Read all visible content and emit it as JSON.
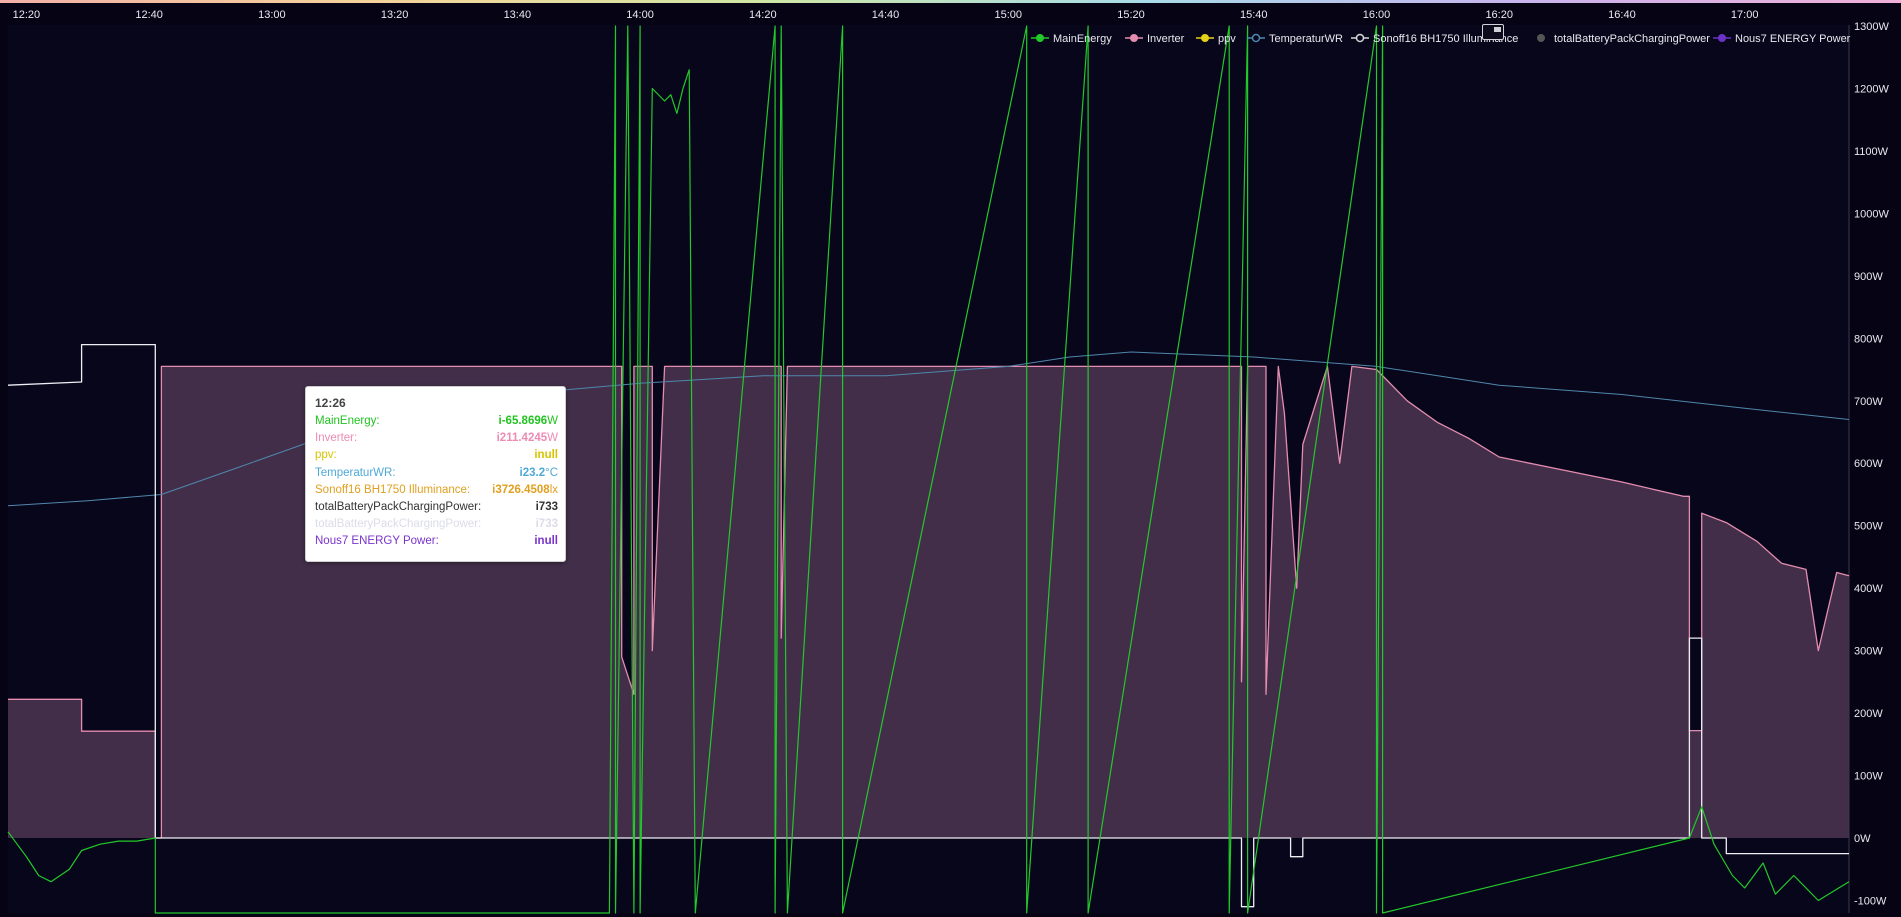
{
  "panel": {
    "title": "",
    "background": "#060414"
  },
  "colors": {
    "main_energy": "#22c92a",
    "inverter": "#e48db0",
    "inverter_fill": "#46304c",
    "ppv": "#e5d217",
    "temperatur_wr": "#4f87ad",
    "sonoff_illuminance": "#e0b52a",
    "battery": "#eeeef4",
    "nous7": "#6c32c8",
    "tooltip_main": "#21c321",
    "tooltip_inverter": "#ee8bb2",
    "tooltip_ppv": "#d8c400",
    "tooltip_temp": "#4fa8d8",
    "tooltip_sonoff": "#e0a020",
    "tooltip_battery": "#333333",
    "tooltip_battery_ghost": "#dcdce8",
    "tooltip_nous": "#7a33cc"
  },
  "legend": [
    {
      "label": "MainEnergy",
      "color": "#22c92a",
      "marker": "line-dot"
    },
    {
      "label": "Inverter",
      "color": "#e48db0",
      "marker": "line-dot"
    },
    {
      "label": "ppv",
      "color": "#e5d217",
      "marker": "line-dot"
    },
    {
      "label": "TemperaturWR",
      "color": "#4f87ad",
      "marker": "line-ring"
    },
    {
      "label": "Sonoff16  BH1750  Illuminance",
      "color": "#d8d8d8",
      "marker": "line-ring"
    },
    {
      "label": "totalBatteryPackChargingPower",
      "color": "#555555",
      "marker": "dot"
    },
    {
      "label": "Nous7 ENERGY  Power",
      "color": "#6c32c8",
      "marker": "line-dot"
    }
  ],
  "tooltip": {
    "time": "12:26",
    "rows": [
      {
        "label": "MainEnergy:",
        "value": "-65.8696",
        "unit": "W",
        "color": "#21c321"
      },
      {
        "label": "Inverter:",
        "value": "211.4245",
        "unit": "W",
        "color": "#ee8bb2"
      },
      {
        "label": "ppv:",
        "value": "null",
        "unit": "",
        "color": "#d8c400"
      },
      {
        "label": "TemperaturWR:",
        "value": "23.2",
        "unit": "°C",
        "color": "#4fa8d8"
      },
      {
        "label": "Sonoff16 BH1750 Illuminance:",
        "value": "3726.4508",
        "unit": "lx",
        "color": "#e0a020"
      },
      {
        "label": "totalBatteryPackChargingPower:",
        "value": "733",
        "unit": "",
        "color": "#333333"
      },
      {
        "label": "totalBatteryPackChargingPower:",
        "value": "733",
        "unit": "",
        "color": "#dcdce8"
      },
      {
        "label": "Nous7 ENERGY Power:",
        "value": "null",
        "unit": "",
        "color": "#7a33cc"
      }
    ]
  },
  "chart_data": {
    "type": "line",
    "x_ticks": [
      "12:20",
      "12:40",
      "13:00",
      "13:20",
      "13:40",
      "14:00",
      "14:20",
      "14:40",
      "15:00",
      "15:20",
      "15:40",
      "16:00",
      "16:20",
      "16:40",
      "17:00"
    ],
    "x_range": [
      "12:17",
      "17:17"
    ],
    "y_ticks": [
      "1300W",
      "1200W",
      "1100W",
      "1000W",
      "900W",
      "800W",
      "700W",
      "600W",
      "500W",
      "400W",
      "300W",
      "200W",
      "100W",
      "0W",
      "-100W"
    ],
    "ylim": [
      -120,
      1300
    ],
    "grid": false,
    "legend_position": "top-right",
    "series": [
      {
        "name": "Inverter",
        "color": "#e48db0",
        "fill": true,
        "points": [
          [
            "12:17",
            222
          ],
          [
            "12:29",
            222
          ],
          [
            "12:29",
            171
          ],
          [
            "12:41",
            171
          ],
          [
            "12:41",
            0
          ],
          [
            "12:42",
            0
          ],
          [
            "12:42",
            755
          ],
          [
            "13:57",
            755
          ],
          [
            "13:57",
            290
          ],
          [
            "13:59",
            230
          ],
          [
            "13:59",
            755
          ],
          [
            "14:02",
            755
          ],
          [
            "14:02",
            300
          ],
          [
            "14:04",
            755
          ],
          [
            "14:23",
            755
          ],
          [
            "14:23",
            320
          ],
          [
            "14:24",
            755
          ],
          [
            "15:38",
            755
          ],
          [
            "15:38",
            250
          ],
          [
            "15:39",
            755
          ],
          [
            "15:42",
            755
          ],
          [
            "15:42",
            230
          ],
          [
            "15:44",
            755
          ],
          [
            "15:45",
            680
          ],
          [
            "15:47",
            400
          ],
          [
            "15:48",
            630
          ],
          [
            "15:52",
            755
          ],
          [
            "15:54",
            600
          ],
          [
            "15:56",
            755
          ],
          [
            "16:00",
            750
          ],
          [
            "16:05",
            700
          ],
          [
            "16:10",
            665
          ],
          [
            "16:15",
            640
          ],
          [
            "16:20",
            610
          ],
          [
            "16:30",
            590
          ],
          [
            "16:40",
            570
          ],
          [
            "16:50",
            547
          ],
          [
            "16:51",
            547
          ],
          [
            "16:51",
            172
          ],
          [
            "16:53",
            172
          ],
          [
            "16:53",
            520
          ],
          [
            "16:57",
            505
          ],
          [
            "17:02",
            475
          ],
          [
            "17:06",
            440
          ],
          [
            "17:10",
            430
          ],
          [
            "17:12",
            300
          ],
          [
            "17:15",
            425
          ],
          [
            "17:17",
            420
          ]
        ]
      },
      {
        "name": "TemperaturWR",
        "color": "#4f87ad",
        "fill": false,
        "points": [
          [
            "12:17",
            532
          ],
          [
            "12:30",
            540
          ],
          [
            "12:42",
            550
          ],
          [
            "12:55",
            595
          ],
          [
            "13:05",
            630
          ],
          [
            "13:10",
            650
          ],
          [
            "13:20",
            685
          ],
          [
            "13:35",
            705
          ],
          [
            "13:45",
            715
          ],
          [
            "14:00",
            728
          ],
          [
            "14:20",
            740
          ],
          [
            "14:40",
            740
          ],
          [
            "15:00",
            755
          ],
          [
            "15:10",
            770
          ],
          [
            "15:20",
            778
          ],
          [
            "15:40",
            770
          ],
          [
            "16:00",
            755
          ],
          [
            "16:10",
            740
          ],
          [
            "16:20",
            725
          ],
          [
            "16:40",
            710
          ],
          [
            "17:00",
            688
          ],
          [
            "17:17",
            670
          ]
        ]
      },
      {
        "name": "totalBatteryPackChargingPower",
        "color": "#eeeef4",
        "fill": false,
        "points": [
          [
            "12:17",
            725
          ],
          [
            "12:29",
            730
          ],
          [
            "12:29",
            790
          ],
          [
            "12:41",
            790
          ],
          [
            "12:41",
            0
          ],
          [
            "15:38",
            0
          ],
          [
            "15:38",
            -110
          ],
          [
            "15:40",
            -110
          ],
          [
            "15:40",
            0
          ],
          [
            "15:46",
            0
          ],
          [
            "15:46",
            -30
          ],
          [
            "15:48",
            -30
          ],
          [
            "15:48",
            0
          ],
          [
            "16:51",
            0
          ],
          [
            "16:51",
            320
          ],
          [
            "16:53",
            320
          ],
          [
            "16:53",
            0
          ],
          [
            "16:57",
            0
          ],
          [
            "16:57",
            -25
          ],
          [
            "17:17",
            -25
          ]
        ]
      },
      {
        "name": "MainEnergy",
        "color": "#22c92a",
        "fill": false,
        "points": [
          [
            "12:17",
            10
          ],
          [
            "12:20",
            -30
          ],
          [
            "12:22",
            -60
          ],
          [
            "12:24",
            -70
          ],
          [
            "12:27",
            -50
          ],
          [
            "12:29",
            -20
          ],
          [
            "12:32",
            -10
          ],
          [
            "12:35",
            -5
          ],
          [
            "12:38",
            -5
          ],
          [
            "12:41",
            0
          ],
          [
            "12:41",
            -130
          ],
          [
            "13:55",
            -130
          ],
          [
            "13:56",
            1300
          ],
          [
            "13:56",
            -130
          ],
          [
            "13:58",
            1300
          ],
          [
            "13:59",
            -130
          ],
          [
            "14:00",
            1300
          ],
          [
            "14:00",
            -130
          ],
          [
            "14:02",
            1200
          ],
          [
            "14:04",
            1180
          ],
          [
            "14:05",
            1190
          ],
          [
            "14:06",
            1160
          ],
          [
            "14:07",
            1200
          ],
          [
            "14:08",
            1230
          ],
          [
            "14:09",
            -130
          ],
          [
            "14:22",
            1300
          ],
          [
            "14:22",
            -130
          ],
          [
            "14:23",
            1300
          ],
          [
            "14:24",
            -130
          ],
          [
            "14:33",
            1300
          ],
          [
            "14:33",
            -130
          ],
          [
            "15:03",
            1300
          ],
          [
            "15:03",
            -130
          ],
          [
            "15:13",
            1300
          ],
          [
            "15:13",
            -130
          ],
          [
            "15:36",
            1300
          ],
          [
            "15:36",
            -130
          ],
          [
            "15:39",
            1300
          ],
          [
            "15:39",
            -130
          ],
          [
            "16:00",
            1300
          ],
          [
            "16:00",
            -130
          ],
          [
            "16:01",
            1300
          ],
          [
            "16:01",
            -130
          ],
          [
            "16:51",
            0
          ],
          [
            "16:53",
            50
          ],
          [
            "16:55",
            -10
          ],
          [
            "16:58",
            -60
          ],
          [
            "17:00",
            -80
          ],
          [
            "17:03",
            -40
          ],
          [
            "17:05",
            -90
          ],
          [
            "17:08",
            -60
          ],
          [
            "17:12",
            -100
          ],
          [
            "17:17",
            -70
          ]
        ]
      }
    ]
  }
}
